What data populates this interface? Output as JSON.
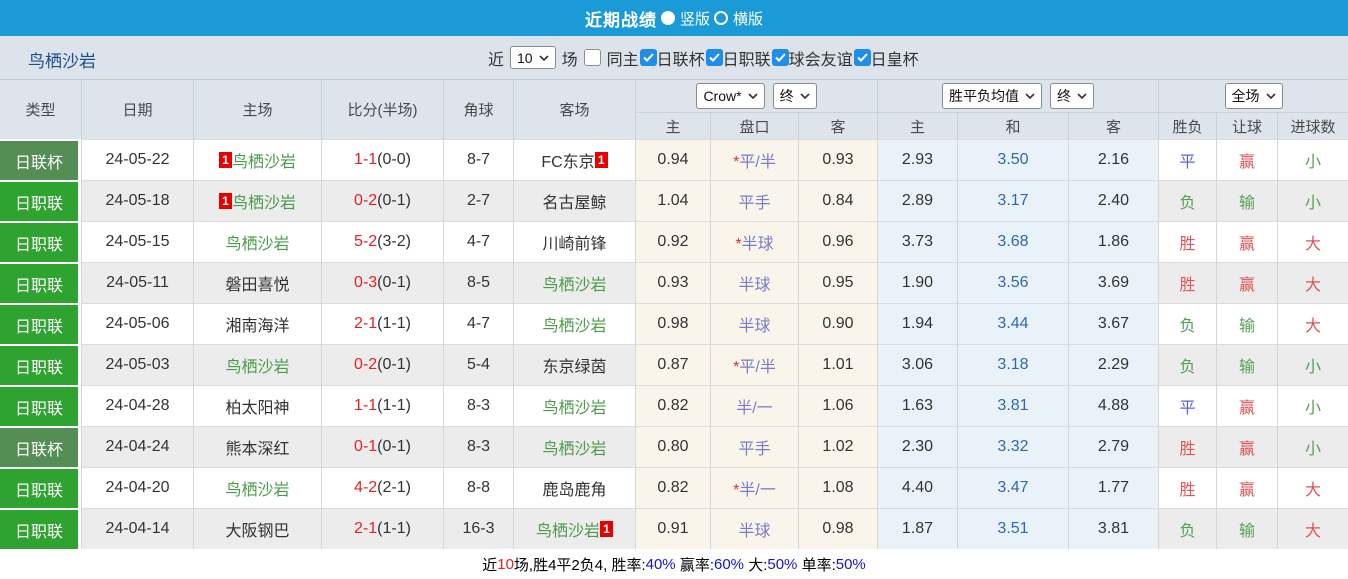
{
  "title_bar": {
    "title": "近期战绩",
    "vertical_option": "竖版",
    "horizontal_option": "横版"
  },
  "filter_bar": {
    "team_name": "鸟栖沙岩",
    "recent_label": "近",
    "recent_count": "10",
    "games_label": "场",
    "same_home_label": "同主",
    "competitions": [
      "日联杯",
      "日职联",
      "球会友谊",
      "日皇杯"
    ]
  },
  "table": {
    "column_headers": {
      "type": "类型",
      "date": "日期",
      "home": "主场",
      "score": "比分(半场)",
      "corner": "角球",
      "away": "客场"
    },
    "dropdowns": [
      "Crow*",
      "终",
      "胜平负均值",
      "终",
      "全场"
    ],
    "sub_headers": [
      "主",
      "盘口",
      "客",
      "主",
      "和",
      "客",
      "胜负",
      "让球",
      "进球数"
    ],
    "rows": [
      {
        "league": "日联杯",
        "league_style": "cup",
        "date": "24-05-22",
        "home": {
          "name": "鸟栖沙岩",
          "self": true,
          "badge": "1"
        },
        "score_full": "1-1",
        "score_half": "(0-0)",
        "corners": "8-7",
        "away": {
          "name": "FC东京",
          "self": false,
          "badge": "1"
        },
        "ah_home": "0.94",
        "handicap": "*平/半",
        "ah_away": "0.93",
        "avg_home": "2.93",
        "avg_draw": "3.50",
        "avg_away": "2.16",
        "result": {
          "text": "平",
          "color": "blue"
        },
        "handicap_result": {
          "text": "赢",
          "color": "red"
        },
        "goals": {
          "text": "小",
          "color": "green"
        }
      },
      {
        "league": "日职联",
        "league_style": "league",
        "date": "24-05-18",
        "home": {
          "name": "鸟栖沙岩",
          "self": true,
          "badge": "1"
        },
        "score_full": "0-2",
        "score_half": "(0-1)",
        "corners": "2-7",
        "away": {
          "name": "名古屋鲸",
          "self": false
        },
        "ah_home": "1.04",
        "handicap": "平手",
        "ah_away": "0.84",
        "avg_home": "2.89",
        "avg_draw": "3.17",
        "avg_away": "2.40",
        "result": {
          "text": "负",
          "color": "green"
        },
        "handicap_result": {
          "text": "输",
          "color": "green"
        },
        "goals": {
          "text": "小",
          "color": "green"
        }
      },
      {
        "league": "日职联",
        "league_style": "league",
        "date": "24-05-15",
        "home": {
          "name": "鸟栖沙岩",
          "self": true
        },
        "score_full": "5-2",
        "score_half": "(3-2)",
        "corners": "4-7",
        "away": {
          "name": "川崎前锋",
          "self": false
        },
        "ah_home": "0.92",
        "handicap": "*半球",
        "ah_away": "0.96",
        "avg_home": "3.73",
        "avg_draw": "3.68",
        "avg_away": "1.86",
        "result": {
          "text": "胜",
          "color": "red"
        },
        "handicap_result": {
          "text": "赢",
          "color": "red"
        },
        "goals": {
          "text": "大",
          "color": "red"
        }
      },
      {
        "league": "日职联",
        "league_style": "league",
        "date": "24-05-11",
        "home": {
          "name": "磐田喜悦",
          "self": false
        },
        "score_full": "0-3",
        "score_half": "(0-1)",
        "corners": "8-5",
        "away": {
          "name": "鸟栖沙岩",
          "self": true
        },
        "ah_home": "0.93",
        "handicap": "半球",
        "ah_away": "0.95",
        "avg_home": "1.90",
        "avg_draw": "3.56",
        "avg_away": "3.69",
        "result": {
          "text": "胜",
          "color": "red"
        },
        "handicap_result": {
          "text": "赢",
          "color": "red"
        },
        "goals": {
          "text": "大",
          "color": "red"
        }
      },
      {
        "league": "日职联",
        "league_style": "league",
        "date": "24-05-06",
        "home": {
          "name": "湘南海洋",
          "self": false
        },
        "score_full": "2-1",
        "score_half": "(1-1)",
        "corners": "4-7",
        "away": {
          "name": "鸟栖沙岩",
          "self": true
        },
        "ah_home": "0.98",
        "handicap": "半球",
        "ah_away": "0.90",
        "avg_home": "1.94",
        "avg_draw": "3.44",
        "avg_away": "3.67",
        "result": {
          "text": "负",
          "color": "green"
        },
        "handicap_result": {
          "text": "输",
          "color": "green"
        },
        "goals": {
          "text": "大",
          "color": "red"
        }
      },
      {
        "league": "日职联",
        "league_style": "league",
        "date": "24-05-03",
        "home": {
          "name": "鸟栖沙岩",
          "self": true
        },
        "score_full": "0-2",
        "score_half": "(0-1)",
        "corners": "5-4",
        "away": {
          "name": "东京绿茵",
          "self": false
        },
        "ah_home": "0.87",
        "handicap": "*平/半",
        "ah_away": "1.01",
        "avg_home": "3.06",
        "avg_draw": "3.18",
        "avg_away": "2.29",
        "result": {
          "text": "负",
          "color": "green"
        },
        "handicap_result": {
          "text": "输",
          "color": "green"
        },
        "goals": {
          "text": "小",
          "color": "green"
        }
      },
      {
        "league": "日职联",
        "league_style": "league",
        "date": "24-04-28",
        "home": {
          "name": "柏太阳神",
          "self": false
        },
        "score_full": "1-1",
        "score_half": "(1-1)",
        "corners": "8-3",
        "away": {
          "name": "鸟栖沙岩",
          "self": true
        },
        "ah_home": "0.82",
        "handicap": "半/一",
        "ah_away": "1.06",
        "avg_home": "1.63",
        "avg_draw": "3.81",
        "avg_away": "4.88",
        "result": {
          "text": "平",
          "color": "blue"
        },
        "handicap_result": {
          "text": "赢",
          "color": "red"
        },
        "goals": {
          "text": "小",
          "color": "green"
        }
      },
      {
        "league": "日联杯",
        "league_style": "cup",
        "date": "24-04-24",
        "home": {
          "name": "熊本深红",
          "self": false
        },
        "score_full": "0-1",
        "score_half": "(0-1)",
        "corners": "8-3",
        "away": {
          "name": "鸟栖沙岩",
          "self": true
        },
        "ah_home": "0.80",
        "handicap": "平手",
        "ah_away": "1.02",
        "avg_home": "2.30",
        "avg_draw": "3.32",
        "avg_away": "2.79",
        "result": {
          "text": "胜",
          "color": "red"
        },
        "handicap_result": {
          "text": "赢",
          "color": "red"
        },
        "goals": {
          "text": "小",
          "color": "green"
        }
      },
      {
        "league": "日职联",
        "league_style": "league",
        "date": "24-04-20",
        "home": {
          "name": "鸟栖沙岩",
          "self": true
        },
        "score_full": "4-2",
        "score_half": "(2-1)",
        "corners": "8-8",
        "away": {
          "name": "鹿岛鹿角",
          "self": false
        },
        "ah_home": "0.82",
        "handicap": "*半/一",
        "ah_away": "1.08",
        "avg_home": "4.40",
        "avg_draw": "3.47",
        "avg_away": "1.77",
        "result": {
          "text": "胜",
          "color": "red"
        },
        "handicap_result": {
          "text": "赢",
          "color": "red"
        },
        "goals": {
          "text": "大",
          "color": "red"
        }
      },
      {
        "league": "日职联",
        "league_style": "league",
        "date": "24-04-14",
        "home": {
          "name": "大阪钢巴",
          "self": false
        },
        "score_full": "2-1",
        "score_half": "(1-1)",
        "corners": "16-3",
        "away": {
          "name": "鸟栖沙岩",
          "self": true,
          "badge": "1"
        },
        "ah_home": "0.91",
        "handicap": "半球",
        "ah_away": "0.98",
        "avg_home": "1.87",
        "avg_draw": "3.51",
        "avg_away": "3.81",
        "result": {
          "text": "负",
          "color": "green"
        },
        "handicap_result": {
          "text": "输",
          "color": "green"
        },
        "goals": {
          "text": "大",
          "color": "red"
        }
      }
    ]
  },
  "footer": {
    "segments": [
      {
        "text": "近",
        "color": "dark"
      },
      {
        "text": "10",
        "color": "red"
      },
      {
        "text": "场,胜4平2负4, 胜率:",
        "color": "dark"
      },
      {
        "text": "40%",
        "color": "blue"
      },
      {
        "text": " 赢率:",
        "color": "dark"
      },
      {
        "text": "60%",
        "color": "blue"
      },
      {
        "text": " 大:",
        "color": "dark"
      },
      {
        "text": "50%",
        "color": "blue"
      },
      {
        "text": " 单率:",
        "color": "dark"
      },
      {
        "text": "50%",
        "color": "blue"
      }
    ]
  },
  "colors": {
    "accent_blue": "#1b9ad8",
    "league_badge_green": "#2fa32f",
    "cup_badge_green": "#558e55",
    "win_red": "#dd5555",
    "lose_green": "#55a055",
    "draw_blue": "#6060d8",
    "score_red": "#e52222",
    "handicap_purple": "#7b7bcb",
    "avg_draw_blue": "#3068ad"
  }
}
